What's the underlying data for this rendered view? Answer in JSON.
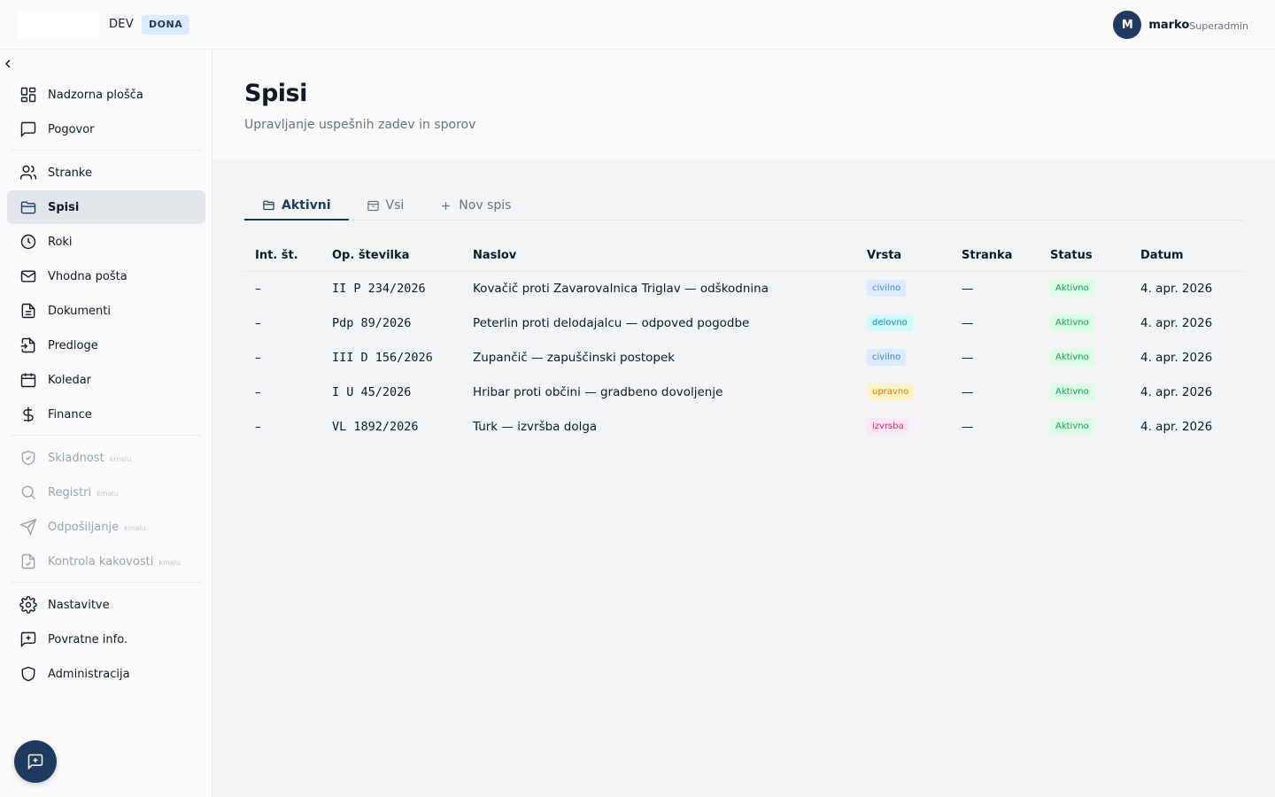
{
  "topbar": {
    "env": "DEV",
    "env_badge": "DONA",
    "user": {
      "initial": "M",
      "name": "marko",
      "role": "Superadmin"
    }
  },
  "sidebar": {
    "items": [
      {
        "label": "Nadzorna plošča",
        "icon": "dashboard-icon"
      },
      {
        "label": "Pogovor",
        "icon": "chat-icon"
      },
      {
        "label": "Stranke",
        "icon": "users-icon"
      },
      {
        "label": "Spisi",
        "icon": "folder-icon"
      },
      {
        "label": "Roki",
        "icon": "clock-icon"
      },
      {
        "label": "Vhodna pošta",
        "icon": "mail-icon"
      },
      {
        "label": "Dokumenti",
        "icon": "document-icon"
      },
      {
        "label": "Predloge",
        "icon": "template-icon"
      },
      {
        "label": "Koledar",
        "icon": "calendar-icon"
      },
      {
        "label": "Finance",
        "icon": "dollar-icon"
      },
      {
        "label": "Skladnost",
        "icon": "shield-check-icon",
        "soon": "kmalu"
      },
      {
        "label": "Registri",
        "icon": "search-icon",
        "soon": "kmalu"
      },
      {
        "label": "Odpošiljanje",
        "icon": "send-icon",
        "soon": "kmalu"
      },
      {
        "label": "Kontrola kakovosti",
        "icon": "file-check-icon",
        "soon": "kmalu"
      },
      {
        "label": "Nastavitve",
        "icon": "gear-icon"
      },
      {
        "label": "Povratne info.",
        "icon": "feedback-icon"
      },
      {
        "label": "Administracija",
        "icon": "shield-icon"
      }
    ]
  },
  "page": {
    "title": "Spisi",
    "subtitle": "Upravljanje uspešnih zadev in sporov"
  },
  "tabs": [
    {
      "label": "Aktivni"
    },
    {
      "label": "Vsi"
    },
    {
      "label": "Nov spis"
    }
  ],
  "table": {
    "headers": [
      "Int. št.",
      "Op. številka",
      "Naslov",
      "Vrsta",
      "Stranka",
      "Status",
      "Datum"
    ],
    "rows": [
      {
        "int": "–",
        "op": "II P 234/2026",
        "title": "Kovačič proti Zavarovalnica Triglav — odškodnina",
        "type": "civilno",
        "client": "—",
        "status": "Aktivno",
        "date": "4. apr. 2026"
      },
      {
        "int": "–",
        "op": "Pdp 89/2026",
        "title": "Peterlin proti delodajalcu — odpoved pogodbe",
        "type": "delovno",
        "client": "—",
        "status": "Aktivno",
        "date": "4. apr. 2026"
      },
      {
        "int": "–",
        "op": "III D 156/2026",
        "title": "Zupančič — zapuščinski postopek",
        "type": "civilno",
        "client": "—",
        "status": "Aktivno",
        "date": "4. apr. 2026"
      },
      {
        "int": "–",
        "op": "I U 45/2026",
        "title": "Hribar proti občini — gradbeno dovoljenje",
        "type": "upravno",
        "client": "—",
        "status": "Aktivno",
        "date": "4. apr. 2026"
      },
      {
        "int": "–",
        "op": "VL 1892/2026",
        "title": "Turk — izvršba dolga",
        "type": "izvrsba",
        "client": "—",
        "status": "Aktivno",
        "date": "4. apr. 2026"
      }
    ]
  },
  "colors": {
    "accent": "#1e3a5f",
    "civilno": "#3b82f6",
    "delovno": "#0891b2",
    "upravno": "#d97706",
    "izvrsba": "#db2777",
    "status_active": "#16a34a"
  }
}
